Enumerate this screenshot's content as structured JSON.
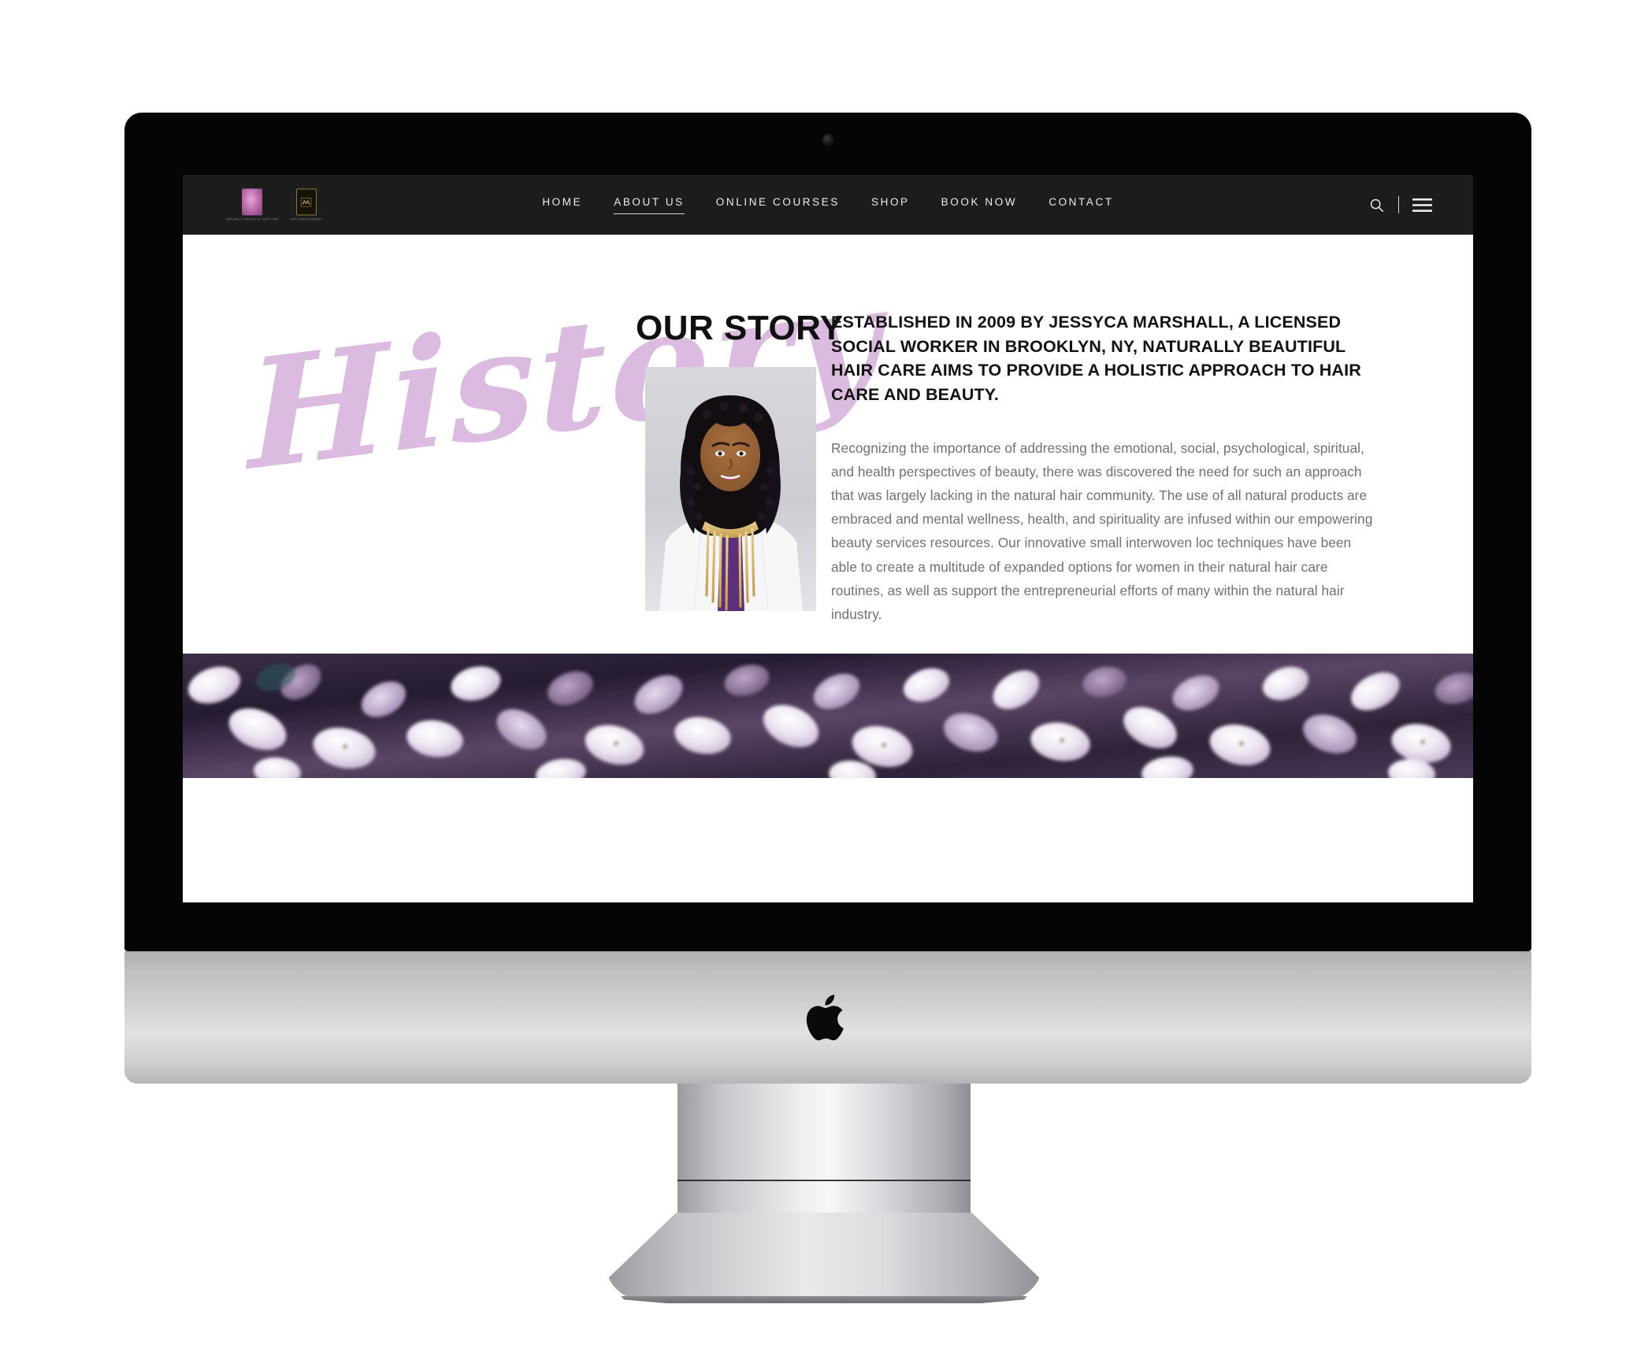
{
  "device": {
    "name": "iMac desktop computer mockup",
    "brand_logo": "apple-logo",
    "webcam": "webcam-dot"
  },
  "site": {
    "nav": {
      "logo_badges": [
        {
          "id": "logo-badge-primary",
          "caption": "NATURALLY BEAUTIFUL HAIR CARE",
          "color": "#bf6fae"
        },
        {
          "id": "logo-badge-secondary",
          "caption": "HAIR CARE ACADEMY",
          "color": "#8d7a33"
        }
      ],
      "links": [
        {
          "label": "HOME",
          "active": false
        },
        {
          "label": "ABOUT US",
          "active": true
        },
        {
          "label": "ONLINE COURSES",
          "active": false
        },
        {
          "label": "SHOP",
          "active": false
        },
        {
          "label": "BOOK NOW",
          "active": false
        },
        {
          "label": "CONTACT",
          "active": false
        }
      ],
      "tools": [
        {
          "icon": "search-icon",
          "label": "Search"
        },
        {
          "icon": "hamburger-menu-icon",
          "label": "Menu"
        }
      ],
      "background_color": "#1c1c1c",
      "text_color": "#ececec"
    },
    "hero": {
      "script_word": "History",
      "script_color": "#dcbbe0",
      "heading": "OUR STORY",
      "heading_color": "#101010",
      "portrait_alt": "Jessyca Marshall portrait, white blazer, purple top, gold fringe necklace",
      "lede": "ESTABLISHED IN 2009 BY JESSYCA MARSHALL, A LICENSED SOCIAL WORKER IN BROOKLYN, NY, NATURALLY BEAUTIFUL HAIR CARE AIMS TO PROVIDE A HOLISTIC APPROACH TO HAIR CARE AND BEAUTY.",
      "body": "Recognizing the importance of addressing the emotional, social, psychological, spiritual, and health perspectives of beauty, there was discovered the need for such an approach that was largely lacking in the natural hair community. The use of all natural products are embraced and mental wellness, health, and spirituality are infused within our empowering beauty services resources. Our innovative small interwoven loc techniques have been able to create a multitude of expanded options for women in their natural hair care routines, as well as support the entrepreneurial efforts of many within the natural hair industry.",
      "body_color": "#6e7276"
    },
    "floral_band": {
      "alt": "Lilac blossom photograph banner",
      "colors": [
        "#f2eef4",
        "#cfc2d8",
        "#8d7494",
        "#5b4566",
        "#2d2338",
        "#e8e3ee"
      ]
    }
  }
}
